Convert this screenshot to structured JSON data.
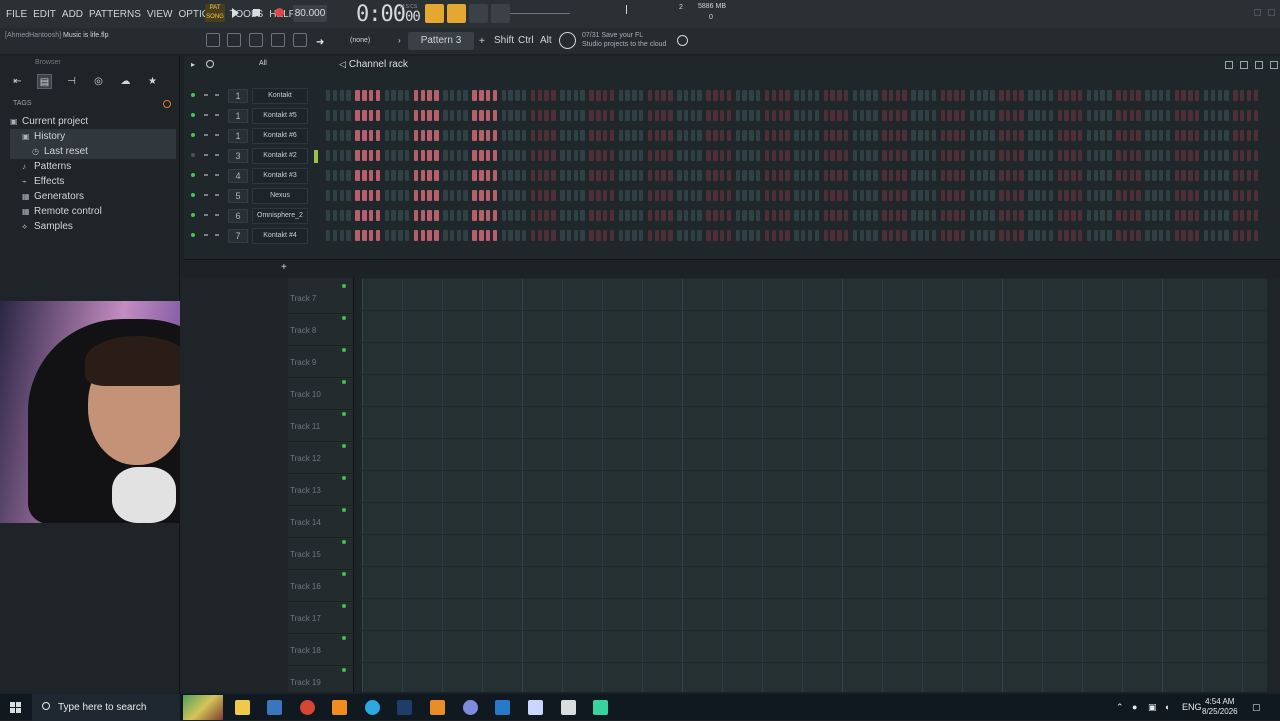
{
  "menu": [
    "FILE",
    "EDIT",
    "ADD",
    "PATTERNS",
    "VIEW",
    "OPTIONS",
    "TOOLS",
    "HELP"
  ],
  "transport": {
    "mode_top": "PAT",
    "mode_bottom": "SONG",
    "tempo": "80.000",
    "time": "0:00",
    "time_cs": "00",
    "time_label": "M:S:CS",
    "cpu_number": "2",
    "memory": "5886 MB",
    "poly": "0"
  },
  "project": {
    "user": "[AhmedHantoosh]",
    "file": "Music is life.flp"
  },
  "toolbar": {
    "pattern_none": "(none)",
    "pattern": "Pattern 3",
    "shift": "Shift",
    "ctrl": "Ctrl",
    "alt": "Alt",
    "hint_date": "07/31",
    "hint_line1": "Save your FL",
    "hint_line2": "Studio projects to the cloud"
  },
  "browser": {
    "title": "Browser",
    "tags": "TAGS",
    "items": [
      {
        "label": "Current project"
      },
      {
        "label": "History"
      },
      {
        "label": "Last reset"
      },
      {
        "label": "Patterns"
      },
      {
        "label": "Effects"
      },
      {
        "label": "Generators"
      },
      {
        "label": "Remote control"
      },
      {
        "label": "Samples"
      }
    ]
  },
  "channel_rack": {
    "filter": "All",
    "title": "Channel rack",
    "channels": [
      {
        "number": "1",
        "name": "Kontakt",
        "enabled": true
      },
      {
        "number": "1",
        "name": "Kontakt #5",
        "enabled": true
      },
      {
        "number": "1",
        "name": "Kontakt #6",
        "enabled": true
      },
      {
        "number": "3",
        "name": "Kontakt #2",
        "enabled": false
      },
      {
        "number": "4",
        "name": "Kontakt #3",
        "enabled": true
      },
      {
        "number": "5",
        "name": "Nexus",
        "enabled": true
      },
      {
        "number": "6",
        "name": "Omnisphere_2",
        "enabled": true
      },
      {
        "number": "7",
        "name": "Kontakt #4",
        "enabled": true
      }
    ]
  },
  "playlist": {
    "tracks": [
      "Track 7",
      "Track 8",
      "Track 9",
      "Track 10",
      "Track 11",
      "Track 12",
      "Track 13",
      "Track 14",
      "Track 15",
      "Track 16",
      "Track 17",
      "Track 18",
      "Track 19"
    ]
  },
  "taskbar": {
    "search_placeholder": "Type here to search",
    "language": "ENG",
    "time": "4:54 AM",
    "date": "8/25/2026"
  },
  "colors": {
    "accent": "#e4a72f",
    "step_on": "#b75f6b",
    "led_on": "#45c54f"
  }
}
